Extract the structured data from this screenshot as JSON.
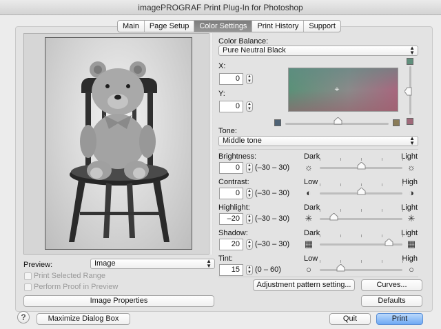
{
  "window": {
    "title": "imagePROGRAF Print Plug-In for Photoshop"
  },
  "tabs": [
    {
      "label": "Main",
      "active": false
    },
    {
      "label": "Page Setup",
      "active": false
    },
    {
      "label": "Color Settings",
      "active": true
    },
    {
      "label": "Print History",
      "active": false
    },
    {
      "label": "Support",
      "active": false
    }
  ],
  "preview": {
    "label": "Preview:",
    "selected": "Image",
    "print_selected_range": "Print Selected Range",
    "perform_proof": "Perform Proof in Preview",
    "image_properties_button": "Image Properties"
  },
  "color_balance": {
    "label": "Color Balance:",
    "selected": "Pure Neutral Black",
    "x_label": "X:",
    "x_value": "0",
    "y_label": "Y:",
    "y_value": "0",
    "colors": {
      "top": "#5f8f7c",
      "left": "#4e6275",
      "right": "#8a7c58",
      "bottom_right": "#a0697a"
    }
  },
  "tone": {
    "label": "Tone:",
    "selected": "Middle tone"
  },
  "adjustments": [
    {
      "key": "brightness",
      "label": "Brightness:",
      "value": "0",
      "range": "(–30 – 30)",
      "low": "Dark",
      "high": "Light",
      "level": 0.5
    },
    {
      "key": "contrast",
      "label": "Contrast:",
      "value": "0",
      "range": "(–30 – 30)",
      "low": "Low",
      "high": "High",
      "level": 0.5
    },
    {
      "key": "highlight",
      "label": "Highlight:",
      "value": "–20",
      "range": "(–30 – 30)",
      "low": "Dark",
      "high": "Light",
      "level": 0.17
    },
    {
      "key": "shadow",
      "label": "Shadow:",
      "value": "20",
      "range": "(–30 – 30)",
      "low": "Dark",
      "high": "Light",
      "level": 0.83
    },
    {
      "key": "tint",
      "label": "Tint:",
      "value": "15",
      "range": "(0 – 60)",
      "low": "Low",
      "high": "High",
      "level": 0.25
    }
  ],
  "buttons": {
    "adjustment_pattern": "Adjustment pattern setting...",
    "curves": "Curves...",
    "defaults": "Defaults",
    "maximize": "Maximize Dialog Box",
    "quit": "Quit",
    "print": "Print",
    "help": "?"
  },
  "accent": "#6ea9f4"
}
